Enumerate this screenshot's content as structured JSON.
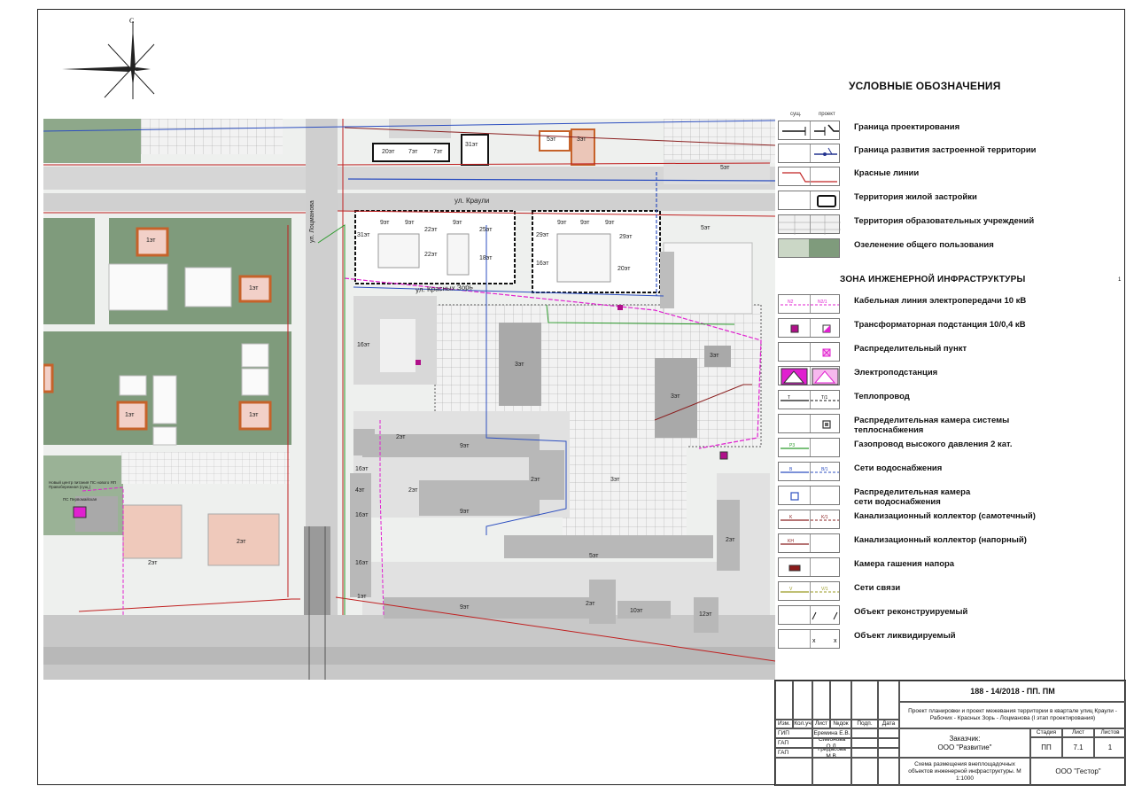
{
  "compass": {
    "north_label": "С"
  },
  "legend": {
    "title": "УСЛОВНЫЕ ОБОЗНАЧЕНИЯ",
    "col_existing": "сущ.",
    "col_project": "проект",
    "section_engineering": "ЗОНА ИНЖЕНЕРНОЙ ИНФРАСТРУКТУРЫ",
    "items": [
      {
        "label": "Граница проектирования"
      },
      {
        "label": "Граница развития застроенной территории"
      },
      {
        "label": "Красные линии"
      },
      {
        "label": "Территория жилой застройки"
      },
      {
        "label": "Территория образовательных учреждений"
      },
      {
        "label": "Озеленение общего пользования"
      },
      {
        "label": "Кабельная линия электропередачи 10 кВ",
        "code_a": "N2",
        "code_b": "N2/1"
      },
      {
        "label": "Трансформаторная подстанция 10/0,4 кВ"
      },
      {
        "label": "Распределительный пункт"
      },
      {
        "label": "Электроподстанция"
      },
      {
        "label": "Теплопровод",
        "code_a": "T",
        "code_b": "T/1"
      },
      {
        "label": "Распределительная камера системы теплоснабжения"
      },
      {
        "label": "Газопровод высокого давления 2 кат.",
        "code_a": "P3"
      },
      {
        "label": "Сети водоснабжения",
        "code_a": "B",
        "code_b": "B/1"
      },
      {
        "label": "Распределительная камера сети водоснабжения"
      },
      {
        "label": "Канализационный коллектор (самотечный)",
        "code_a": "K",
        "code_b": "K/1"
      },
      {
        "label": "Канализационный коллектор (напорный)",
        "code_a": "KH"
      },
      {
        "label": "Камера гашения напора"
      },
      {
        "label": "Сети связи",
        "code_a": "V",
        "code_b": "V/1"
      },
      {
        "label": "Объект реконструируемый"
      },
      {
        "label": "Объект ликвидируемый"
      }
    ],
    "scale_mark": "1"
  },
  "map": {
    "streets": [
      "ул. Краули",
      "ул. Красных Зорь",
      "ул. Лоцманова"
    ],
    "buildings": [
      "20эт",
      "7эт",
      "7эт",
      "31эт",
      "5эт",
      "3эт",
      "5эт",
      "31эт",
      "9эт",
      "9эт",
      "22эт",
      "9эт",
      "25эт",
      "22эт",
      "18эт",
      "29эт",
      "9эт",
      "9эт",
      "9эт",
      "29эт",
      "16эт",
      "20эт",
      "5эт",
      "1эт",
      "1эт",
      "1эт",
      "1эт",
      "16эт",
      "3эт",
      "3эт",
      "3эт",
      "2эт",
      "9эт",
      "2эт",
      "16эт",
      "4эт",
      "16эт",
      "2эт",
      "9эт",
      "16эт",
      "1эт",
      "5эт",
      "2эт",
      "9эт",
      "2эт",
      "10эт",
      "12эт",
      "2эт",
      "2эт",
      "3эт"
    ],
    "substation_label": "ПС Первомайская",
    "power_center_note": "Новый центр питания ПС нового ЯП Правобережная (сущ.)"
  },
  "stamp": {
    "code": "188 - 14/2018 - ПП. ПМ",
    "project_title": "Проект планировки и проект межевания территории в квартале улиц Краули - Рабочих - Красных Зорь - Лоцманова (I этап проектирования)",
    "headers": [
      "Изм.",
      "Кол.уч",
      "Лист",
      "№док",
      "Подп.",
      "Дата"
    ],
    "roles": [
      {
        "role": "ГИП",
        "name": "Еремина Е.В."
      },
      {
        "role": "ГАП",
        "name": "Симонова О.Л."
      },
      {
        "role": "ГАП",
        "name": "Гридасова М.В."
      }
    ],
    "customer_label": "Заказчик:",
    "customer": "ООО \"Развитие\"",
    "stage_label": "Стадия",
    "sheet_label": "Лист",
    "sheets_label": "Листов",
    "stage": "ПП",
    "sheet": "7.1",
    "sheets": "1",
    "drawing_title": "Схема размещения внеплощадочных объектов инженерной инфраструктуры. М 1:1000",
    "company": "ООО \"Гестор\""
  }
}
